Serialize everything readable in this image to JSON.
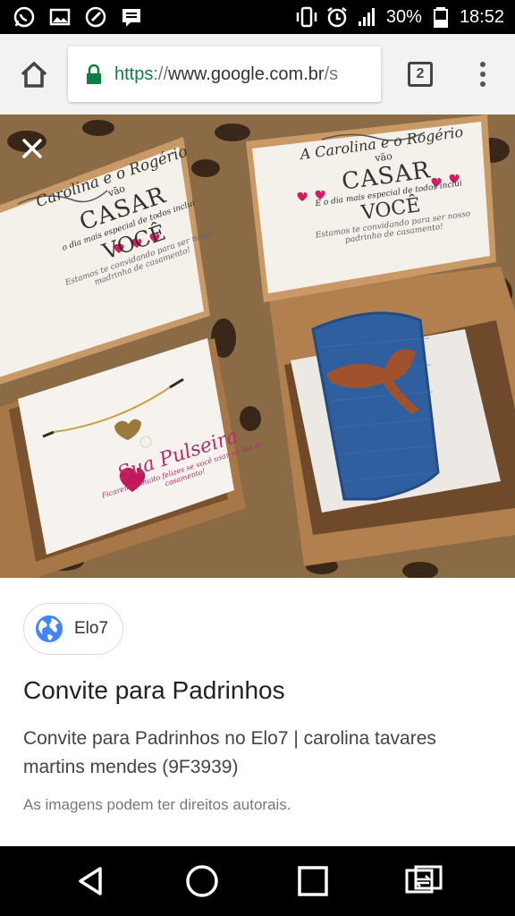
{
  "status_bar": {
    "battery": "30%",
    "time": "18:52",
    "icons": [
      "whatsapp-icon",
      "image-icon",
      "speedometer-icon",
      "message-icon",
      "vibrate-icon",
      "alarm-icon",
      "signal-icon",
      "battery-icon"
    ]
  },
  "browser": {
    "url_scheme": "https",
    "url_separator": "://",
    "url_host": "www.google.com.br",
    "url_rest": "/s",
    "tab_count": "2"
  },
  "image": {
    "close_icon": "close-icon",
    "left_card": {
      "names": "Carolina e o Rogério",
      "vao": "vão",
      "casar": "CASAR",
      "dia": "o dia mais especial de todos inclui",
      "voce": "VOCÊ",
      "convite": "Estamos te convidando para ser nossa madrinha de casamento!",
      "pulseira": "Sua Pulseira",
      "pulseira_note": "Ficaremos muito felizes se você usar no dia do casamento!"
    },
    "right_card": {
      "names": "A Carolina e o Rogério",
      "vao": "vão",
      "casar": "CASAR",
      "dia": "E o dia mais especial de todos inclui",
      "voce": "VOCÊ",
      "convite": "Estamos te convidando para ser nosso padrinho de casamento!"
    }
  },
  "result": {
    "source": "Elo7",
    "title": "Convite para Padrinhos",
    "description": "Convite para Padrinhos no Elo7 | carolina tavares martins mendes (9F3939)",
    "copyright": "As imagens podem ter direitos autorais."
  },
  "colors": {
    "url_green": "#0b8043",
    "heart_pink": "#c2185b",
    "tie_blue": "#2f5f9e",
    "wood": "#b9895a"
  }
}
